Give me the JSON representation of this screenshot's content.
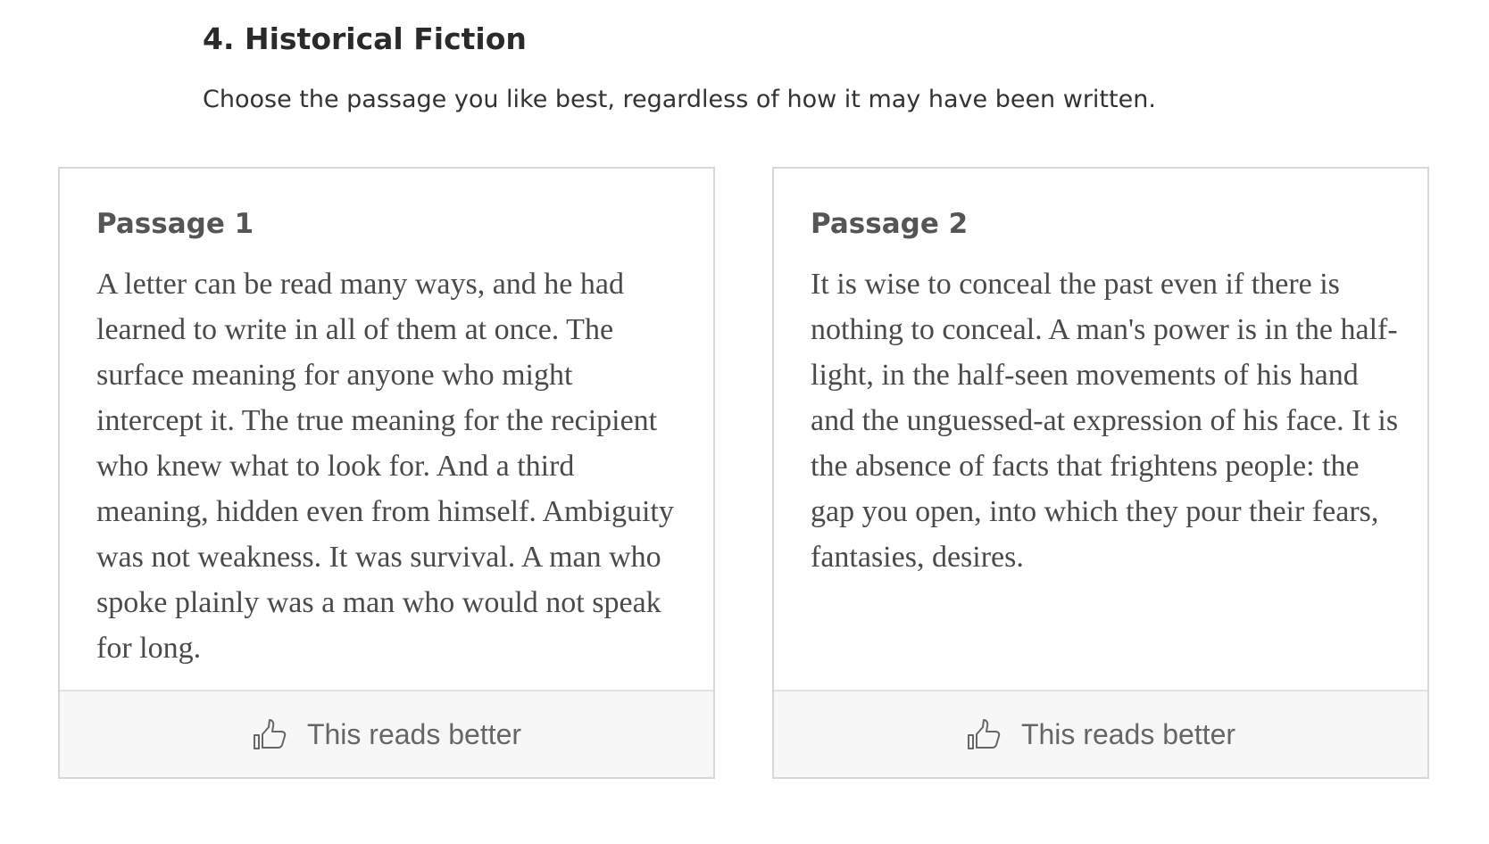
{
  "section": {
    "title": "4. Historical Fiction",
    "instructions": "Choose the passage you like best, regardless of how it may have been written."
  },
  "passages": [
    {
      "title": "Passage 1",
      "text": "A letter can be read many ways, and he had learned to write in all of them at once. The surface meaning for anyone who might intercept it. The true meaning for the recipient who knew what to look for. And a third meaning, hidden even from himself. Ambiguity was not weakness. It was survival. A man who spoke plainly was a man who would not speak for long.",
      "vote_label": "This reads better",
      "vote_icon": "thumbs-up-icon"
    },
    {
      "title": "Passage 2",
      "text": "It is wise to conceal the past even if there is nothing to conceal. A man's power is in the half-light, in the half-seen movements of his hand and the unguessed-at expression of his face. It is the absence of facts that frightens people: the gap you open, into which they pour their fears, fantasies, desires.",
      "vote_label": "This reads better",
      "vote_icon": "thumbs-up-icon"
    }
  ],
  "colors": {
    "card_border": "#d8d8d8",
    "button_background": "#f7f7f7",
    "button_text": "#666666"
  }
}
